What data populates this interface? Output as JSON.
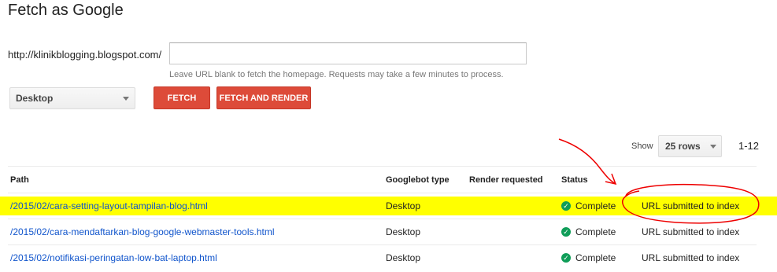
{
  "page": {
    "title": "Fetch as Google"
  },
  "form": {
    "url_prefix": "http://klinikblogging.blogspot.com/",
    "url_value": "",
    "hint": "Leave URL blank to fetch the homepage. Requests may take a few minutes to process.",
    "device": "Desktop",
    "fetch_label": "FETCH",
    "fetch_render_label": "FETCH AND RENDER"
  },
  "pagination": {
    "show_label": "Show",
    "rows_value": "25 rows",
    "range": "1-12"
  },
  "table": {
    "columns": {
      "path": "Path",
      "type": "Googlebot type",
      "render": "Render requested",
      "status": "Status"
    },
    "rows": [
      {
        "path": "/2015/02/cara-setting-layout-tampilan-blog.html",
        "type": "Desktop",
        "render": "",
        "status": "Complete",
        "result": "URL submitted to index"
      },
      {
        "path": "/2015/02/cara-mendaftarkan-blog-google-webmaster-tools.html",
        "type": "Desktop",
        "render": "",
        "status": "Complete",
        "result": "URL submitted to index"
      },
      {
        "path": "/2015/02/notifikasi-peringatan-low-bat-laptop.html",
        "type": "Desktop",
        "render": "",
        "status": "Complete",
        "result": "URL submitted to index"
      }
    ]
  },
  "colors": {
    "accent_button": "#dd4b39",
    "highlight": "#ffff00",
    "annotation": "#ee0000",
    "status_ok": "#0f9d58",
    "link": "#1155cc"
  },
  "icons": {
    "status": "check-circle-icon",
    "dropdown": "chevron-down-icon"
  }
}
